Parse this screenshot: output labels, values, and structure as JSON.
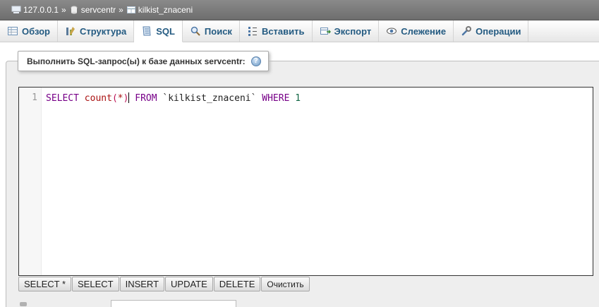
{
  "breadcrumb": {
    "server": "127.0.0.1",
    "database": "servcentr",
    "table": "kilkist_znaceni",
    "separator": "»"
  },
  "tabs": [
    {
      "label": "Обзор",
      "icon": "browse-icon"
    },
    {
      "label": "Структура",
      "icon": "structure-icon"
    },
    {
      "label": "SQL",
      "icon": "sql-icon",
      "active": true
    },
    {
      "label": "Поиск",
      "icon": "search-icon"
    },
    {
      "label": "Вставить",
      "icon": "insert-icon"
    },
    {
      "label": "Экспорт",
      "icon": "export-icon"
    },
    {
      "label": "Слежение",
      "icon": "tracking-icon"
    },
    {
      "label": "Операции",
      "icon": "operations-icon"
    }
  ],
  "sql_panel": {
    "legend": "Выполнить SQL-запрос(ы) к базе данных servcentr:",
    "help_glyph": "?",
    "line_number": "1",
    "query": {
      "select": "SELECT",
      "fn": "count",
      "paren_open": "(",
      "star": "*",
      "paren_close": ")",
      "from": "FROM",
      "table": "`kilkist_znaceni`",
      "where": "WHERE",
      "value": "1"
    }
  },
  "buttons": [
    {
      "label": "SELECT *"
    },
    {
      "label": "SELECT"
    },
    {
      "label": "INSERT"
    },
    {
      "label": "UPDATE"
    },
    {
      "label": "DELETE"
    },
    {
      "label": "Очистить"
    }
  ]
}
